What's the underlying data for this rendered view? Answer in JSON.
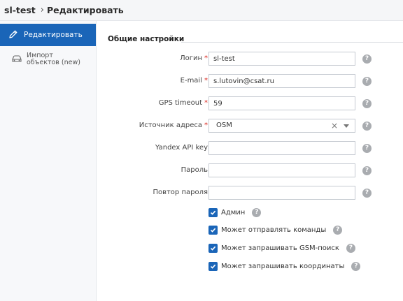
{
  "breadcrumb": {
    "root": "sl-test",
    "separator": "›",
    "current": "Редактировать"
  },
  "sidebar": {
    "items": [
      {
        "label": "Редактировать",
        "icon": "pencil-icon",
        "active": true
      },
      {
        "label_line1": "Импорт",
        "label_line2": "объектов (new)",
        "icon": "car-icon",
        "active": false
      }
    ]
  },
  "form": {
    "section_title": "Общие настройки",
    "required_mark": "*",
    "help_glyph": "?",
    "fields": {
      "login": {
        "label": "Логин",
        "value": "sl-test"
      },
      "email": {
        "label": "E-mail",
        "value": "s.lutovin@csat.ru"
      },
      "gps_timeout": {
        "label": "GPS timeout",
        "value": "59"
      },
      "address_source": {
        "label": "Источник адреса",
        "value": "OSM",
        "clear_glyph": "×"
      },
      "yandex_api_key": {
        "label": "Yandex API key",
        "value": ""
      },
      "password": {
        "label": "Пароль",
        "value": ""
      },
      "password_repeat": {
        "label": "Повтор пароля",
        "value": ""
      }
    },
    "checkboxes": [
      {
        "label": "Админ",
        "checked": true
      },
      {
        "label": "Может отправлять команды",
        "checked": true
      },
      {
        "label": "Может запрашивать GSM-поиск",
        "checked": true
      },
      {
        "label": "Может запрашивать координаты",
        "checked": true
      }
    ]
  },
  "colors": {
    "accent": "#1a65b8",
    "required": "#d9251c",
    "help": "#a9acb0"
  }
}
